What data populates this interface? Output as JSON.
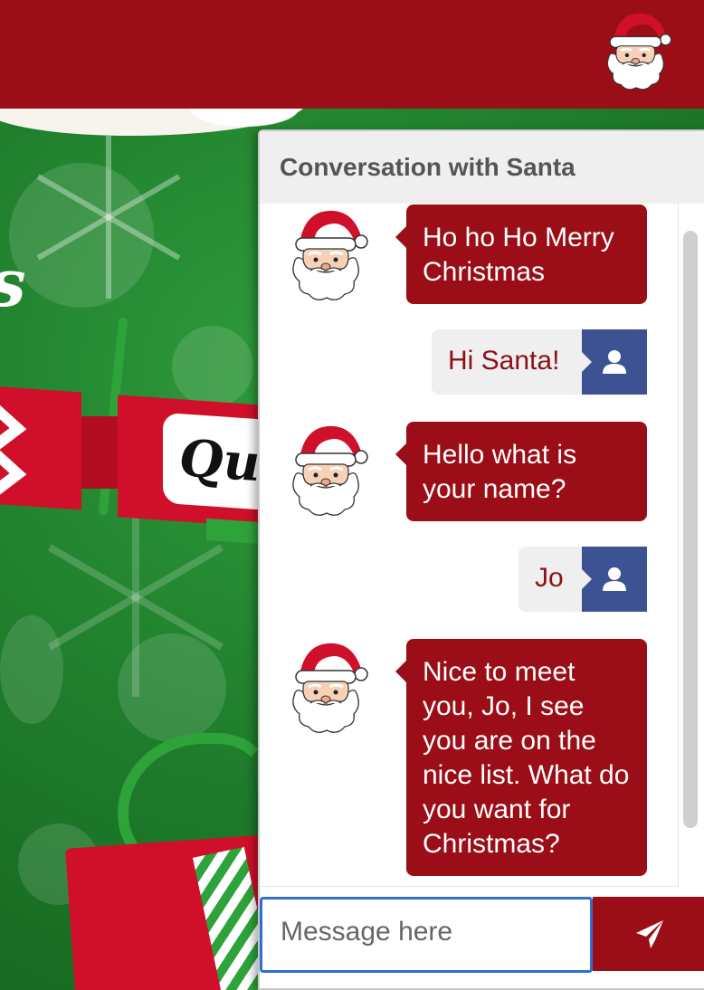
{
  "header": {
    "logo_icon": "santa-face-icon",
    "brand_color": "#9b0e17"
  },
  "background": {
    "cracker_label": "Qui",
    "cursive_text": "s"
  },
  "chat": {
    "title": "Conversation with Santa",
    "messages": [
      {
        "from": "santa",
        "text": "Ho ho Ho Merry Christmas"
      },
      {
        "from": "user",
        "text": "Hi Santa!"
      },
      {
        "from": "santa",
        "text": "Hello what is your name?"
      },
      {
        "from": "user",
        "text": "Jo"
      },
      {
        "from": "santa",
        "text": "Nice to meet you, Jo, I see you are on the nice list. What do you want for Christmas?"
      }
    ],
    "input": {
      "placeholder": "Message here",
      "value": ""
    },
    "send_icon": "paper-plane-icon",
    "user_icon": "user-icon",
    "santa_bubble_color": "#9b0e17",
    "user_badge_color": "#3c5293"
  }
}
